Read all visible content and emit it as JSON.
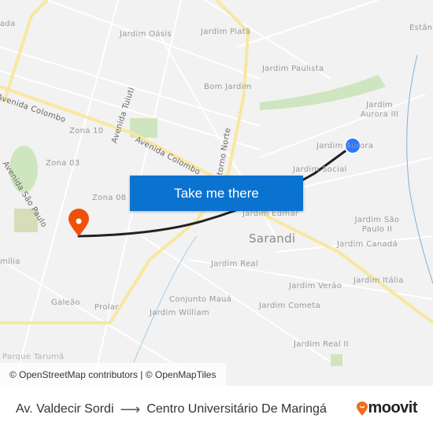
{
  "map": {
    "labels": {
      "ada": "ada",
      "jardim_oasis": "Jardim Oásis",
      "jardim_piata": "Jardim Piatã",
      "estan": "Estân",
      "jardim_paulista": "Jardim Paulista",
      "bom_jardim": "Bom Jardim",
      "jardim_aurora_iii": "Jardim Aurora III",
      "jardim_aurora": "Jardim Aurora",
      "jardim_social": "Jardim Social",
      "zona_10": "Zona 10",
      "zona_03": "Zona 03",
      "zona_08": "Zona 08",
      "jardim_edmar": "Jardim Edmar",
      "sarandi": "Sarandi",
      "jardim_sao_paulo_ii": "Jardim São Paulo II",
      "jardim_canada": "Jardim Canadá",
      "jardim_real": "Jardim Real",
      "jardim_verao": "Jardim Verão",
      "jardim_italia": "Jardim Itália",
      "conjunto_maua": "Conjunto Mauá",
      "jardim_cometa": "Jardim Cometa",
      "jardim_william": "Jardim William",
      "galeao": "Galeão",
      "prolar": "Prolar",
      "milia": "mília",
      "jardim_real_ii": "Jardim Real II",
      "parque_taruma": "Parque Tarumã"
    },
    "roads": {
      "avenida_colombo": "Avenida Colombo",
      "avenida_colombo_2": "Avenida Colombo",
      "avenida_tuiuti": "Avenida Tuiuti",
      "contorno_norte": "ntorno Norte",
      "avenida_sao_paulo": "Avenida São Paulo"
    },
    "origin_color": "#2979ff",
    "destination_color": "#f0500a",
    "route_color": "#222222"
  },
  "cta": {
    "label": "Take me there"
  },
  "attribution": "© OpenStreetMap contributors | © OpenMapTiles",
  "footer": {
    "from": "Av. Valdecir Sordi",
    "to": "Centro Universitário De Maringá",
    "logo": "moovit"
  }
}
